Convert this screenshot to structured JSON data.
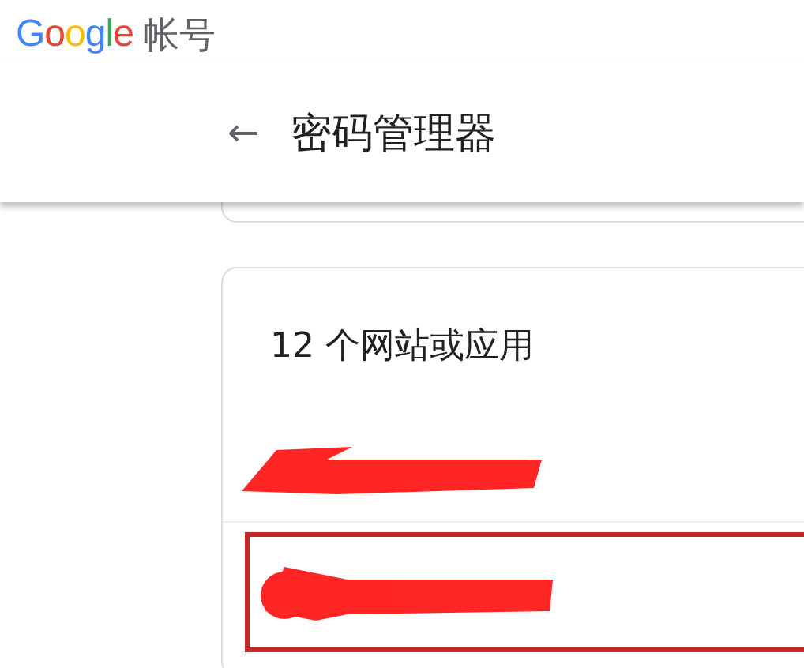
{
  "brand": {
    "logo": "Google",
    "product": "帐号"
  },
  "header": {
    "back": "←",
    "title": "密码管理器"
  },
  "card": {
    "title": "12 个网站或应用",
    "rows": [
      {
        "highlighted": false
      },
      {
        "highlighted": true
      }
    ]
  }
}
